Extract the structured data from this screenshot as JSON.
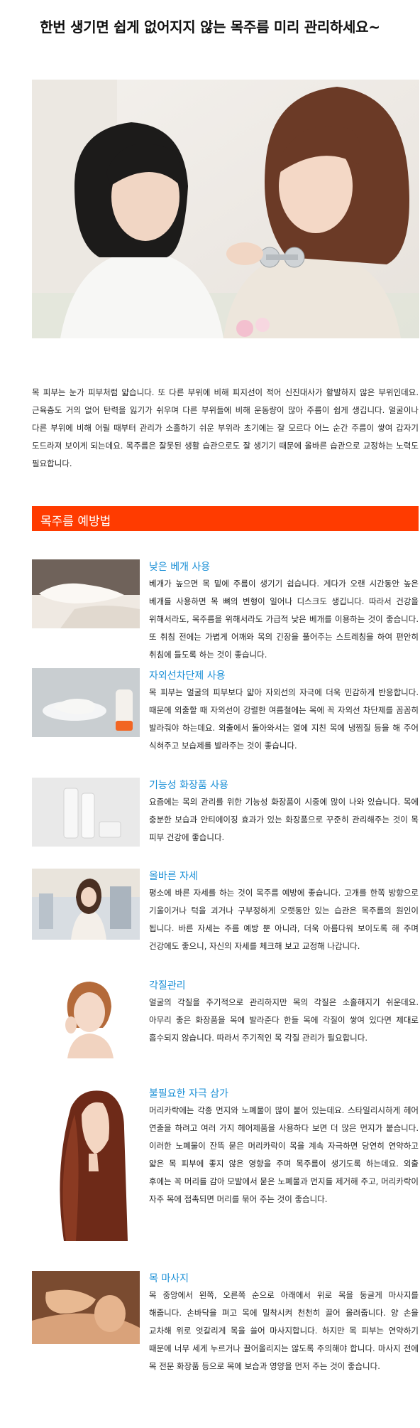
{
  "page": {
    "title": "한번 생기면 쉽게 없어지지 않는 목주름 미리 관리하세요~"
  },
  "intro": "목 피부는 눈가 피부처럼 얇습니다. 또 다른 부위에 비해 피지선이 적어 신진대사가 활발하지 않은 부위인데요. 근육층도 거의 없어 탄력을 잃기가 쉬우며 다른 부위들에 비해 운동량이 많아 주름이 쉽게 생깁니다. 얼굴이나 다른 부위에 비해 어릴 때부터 관리가 소홀하기 쉬운 부위라 초기에는 잘 모르다 어느 순간 주름이 쌓여 갑자기 도드라져 보이게 되는데요. 목주름은 잘못된 생활 습관으로도 잘 생기기 때문에 올바른 습관으로 교정하는 노력도 필요합니다.",
  "section": {
    "title": "목주름 예방법",
    "color": "#ff3b00"
  },
  "items": [
    {
      "heading": "낮은 베개 사용",
      "text": "베개가 높으면 목 밑에 주름이 생기기 쉽습니다. 게다가 오랜 시간동안 높은 베개를 사용하면 목 뼈의 변형이 일어나 디스크도 생깁니다. 따라서 건강을 위해서라도, 목주름을 위해서라도 가급적 낮은 베개를 이용하는 것이 좋습니다. 또 취침 전에는 가볍게 어깨와 목의 긴장을 풀어주는 스트레칭을 하여 편안히 취침에 들도록 하는 것이 좋습니다."
    },
    {
      "heading": "자외선차단제 사용",
      "text": "목 피부는 얼굴의 피부보다 얇아 자외선의 자극에 더욱 민감하게 반응합니다. 때문에 외출할 때 자외선이 강렬한 여름철에는 목에 꼭 자외선 차단제를 꼼꼼히 발라줘야 하는데요. 외출에서 돌아와서는 열에 지친 목에 냉찜질 등을 해 주어 식혀주고 보습제를 발라주는 것이 좋습니다."
    },
    {
      "heading": "기능성 화장품 사용",
      "text": "요즘에는 목의 관리를 위한 기능성 화장품이 시중에 많이 나와 있습니다. 목에 충분한 보습과 안티에이징 효과가 있는 화장품으로 꾸준히 관리해주는 것이 목 피부 건강에 좋습니다."
    },
    {
      "heading": "올바른 자세",
      "text": "평소에 바른 자세를 하는 것이 목주름 예방에 좋습니다. 고개를 한쪽 방향으로 기울이거나 턱을 괴거나 구부정하게 오랫동안 있는 습관은 목주름의 원인이 됩니다. 바른 자세는 주름 예방 뿐 아니라, 더욱 아름다워 보이도록 해 주며 건강에도 좋으니, 자신의 자세를 체크해 보고 교정해 나갑니다."
    },
    {
      "heading": "각질관리",
      "text": "얼굴의 각질을 주기적으로 관리하지만 목의 각질은 소홀해지기 쉬운데요. 아무리 좋은 화장품을 목에 발라준다 한들 목에 각질이 쌓여 있다면 제대로 흡수되지 않습니다. 따라서 주기적인 목 각질 관리가 필요합니다."
    },
    {
      "heading": "불필요한 자극 삼가",
      "text": "머리카락에는 각종 먼지와 노폐물이 많이 붙어 있는데요. 스타일리시하게 헤어 연출을 하려고 여러 가지 헤어제품을 사용하다 보면 더 많은 먼지가 붙습니다. 이러한 노폐물이 잔뜩 묻은 머리카락이 목을 계속 자극하면 당연히 연약하고 얇은 목 피부에 좋지 않은 영향을 주며 목주름이 생기도록 하는데요. 외출 후에는 꼭 머리를 감아 모발에서 묻은 노폐물과 먼지를 제거해 주고, 머리카락이 자주 목에 접촉되면 머리를 묶어 주는 것이 좋습니다."
    },
    {
      "heading": "목 마사지",
      "text": "목 중앙에서 왼쪽, 오른쪽 순으로 아래에서 위로 목을 둥글게 마사지를 해줍니다. 손바닥을 펴고 목에 밀착시켜 천천히 끌어 올려줍니다. 양 손을 교차해 위로 엇갈리게 목을 쓸어 마사지합니다. 하지만 목 피부는 연약하기 때문에 너무 세게 누르거나 끌어올리지는 않도록 주의해야 합니다. 마사지 전에 목 전문 화장품 등으로 목에 보습과 영양을 먼저 주는 것이 좋습니다."
    }
  ],
  "icons": {
    "hero": "two-women-neck-massage-photo",
    "item_images": [
      "pillow-bed-photo",
      "sunscreen-tube-photo",
      "cosmetic-bottles-photo",
      "woman-posture-photo",
      "woman-skincare-photo",
      "long-hair-woman-photo",
      "neck-massage-photo"
    ]
  },
  "colors": {
    "heading": "#1a8fd6",
    "banner": "#ff3b00"
  }
}
